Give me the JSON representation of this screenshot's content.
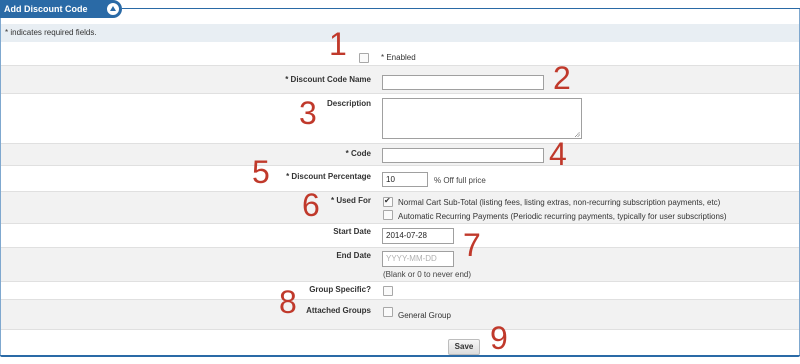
{
  "header": {
    "title": "Add Discount Code"
  },
  "required_note": "* indicates required fields.",
  "enabled": {
    "label": "* Enabled",
    "checked": false
  },
  "discount_code_name": {
    "label": "* Discount Code Name",
    "value": ""
  },
  "description": {
    "label": "Description",
    "value": ""
  },
  "code": {
    "label": "* Code",
    "value": ""
  },
  "discount_percentage": {
    "label": "* Discount Percentage",
    "value": "10",
    "suffix": "% Off full price"
  },
  "used_for": {
    "label": "* Used For",
    "options": [
      {
        "label": "Normal Cart Sub-Total (listing fees, listing extras, non-recurring subscription payments, etc)",
        "checked": true
      },
      {
        "label": "Automatic Recurring Payments (Periodic recurring payments, typically for user subscriptions)",
        "checked": false
      }
    ]
  },
  "start_date": {
    "label": "Start Date",
    "value": "2014-07-28"
  },
  "end_date": {
    "label": "End Date",
    "value": "",
    "placeholder": "YYYY-MM-DD",
    "hint": "(Blank or 0 to never end)"
  },
  "group_specific": {
    "label": "Group Specific?",
    "checked": false
  },
  "attached_groups": {
    "label": "Attached Groups",
    "options": [
      {
        "label": "General Group",
        "checked": false
      }
    ]
  },
  "save_label": "Save",
  "annotations": [
    "1",
    "2",
    "3",
    "4",
    "5",
    "6",
    "7",
    "8",
    "9"
  ],
  "colors": {
    "accent": "#2a6aa6",
    "annotation": "#c0392b",
    "row_shade": "#f2f2f2"
  }
}
